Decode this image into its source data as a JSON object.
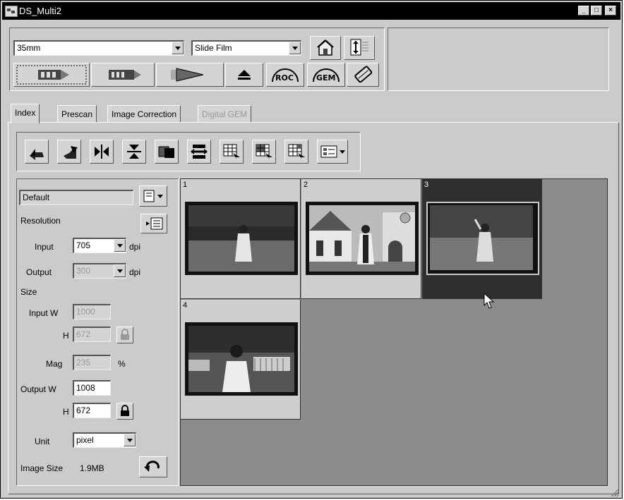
{
  "window": {
    "title": "DS_Multi2"
  },
  "title_buttons": [
    "_",
    "□",
    "×"
  ],
  "toolbar": {
    "film_size": "35mm",
    "film_type": "Slide Film",
    "icons": [
      "index-scan-icon",
      "prescan-icon",
      "scan-icon",
      "eject-icon",
      "roc-icon",
      "gem-icon",
      "help-icon",
      "prefs-icon",
      "settings-icon"
    ],
    "roc_label": "ROC",
    "gem_label": "GEM"
  },
  "tabs": [
    "Index",
    "Prescan",
    "Image Correction",
    "Digital GEM"
  ],
  "settings": {
    "preset": "Default",
    "resolution_label": "Resolution",
    "input_label": "Input",
    "input_value": "705",
    "output_label": "Output",
    "output_value": "300",
    "dpi": "dpi",
    "size_label": "Size",
    "input_w_label": "Input W",
    "input_w": "1000",
    "h_label": "H",
    "input_h": "672",
    "mag_label": "Mag",
    "mag_value": "235",
    "percent": "%",
    "output_w_label": "Output W",
    "output_w": "1008",
    "output_h": "672",
    "unit_label": "Unit",
    "unit_value": "pixel",
    "image_size_label": "Image Size",
    "image_size_value": "1.9MB"
  },
  "thumbnails": [
    {
      "number": "1"
    },
    {
      "number": "2"
    },
    {
      "number": "3"
    },
    {
      "number": "4"
    }
  ],
  "colors": {
    "titlebar": "#000000",
    "panel": "#cbcbcb",
    "grid_bg": "#8c8c8c",
    "selected": "#2f2f2f"
  }
}
